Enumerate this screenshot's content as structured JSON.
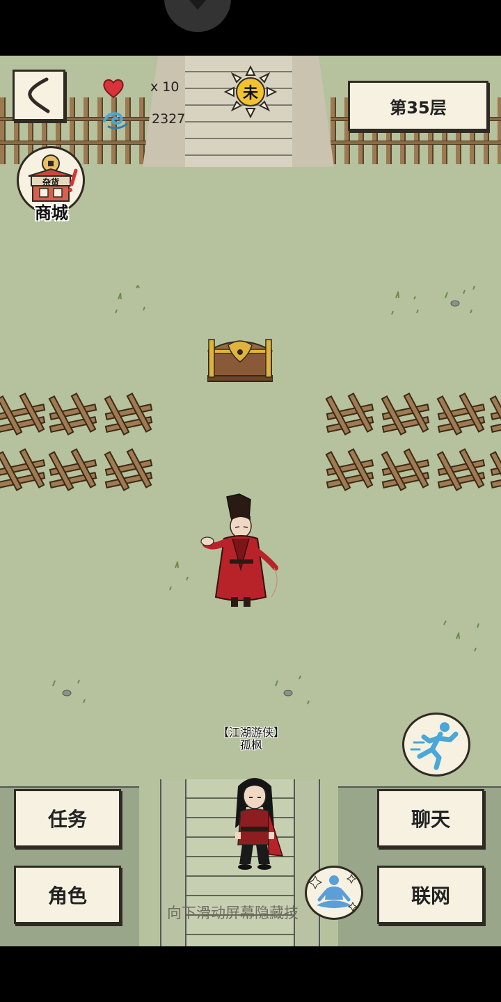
{
  "hud": {
    "back_icon": "back-arrow-icon",
    "lives": "x 10",
    "spirit_points": "2327",
    "time_glyph": "未",
    "floor_label": "第35层"
  },
  "shop": {
    "sign_text": "杂货",
    "label": "商城"
  },
  "player": {
    "title": "【江湖游侠】",
    "name": "孤枫"
  },
  "menu": {
    "tasks": "任务",
    "character": "角色",
    "chat": "聊天",
    "online": "联网"
  },
  "hint": "向下滑动屏幕隐藏技",
  "colors": {
    "ground": "#b5c29d",
    "button_bg": "#f6f1e1",
    "outline": "#2f2a22",
    "heart": "#d8333b",
    "spirit": "#4aa7d8",
    "sun": "#f2c230"
  }
}
